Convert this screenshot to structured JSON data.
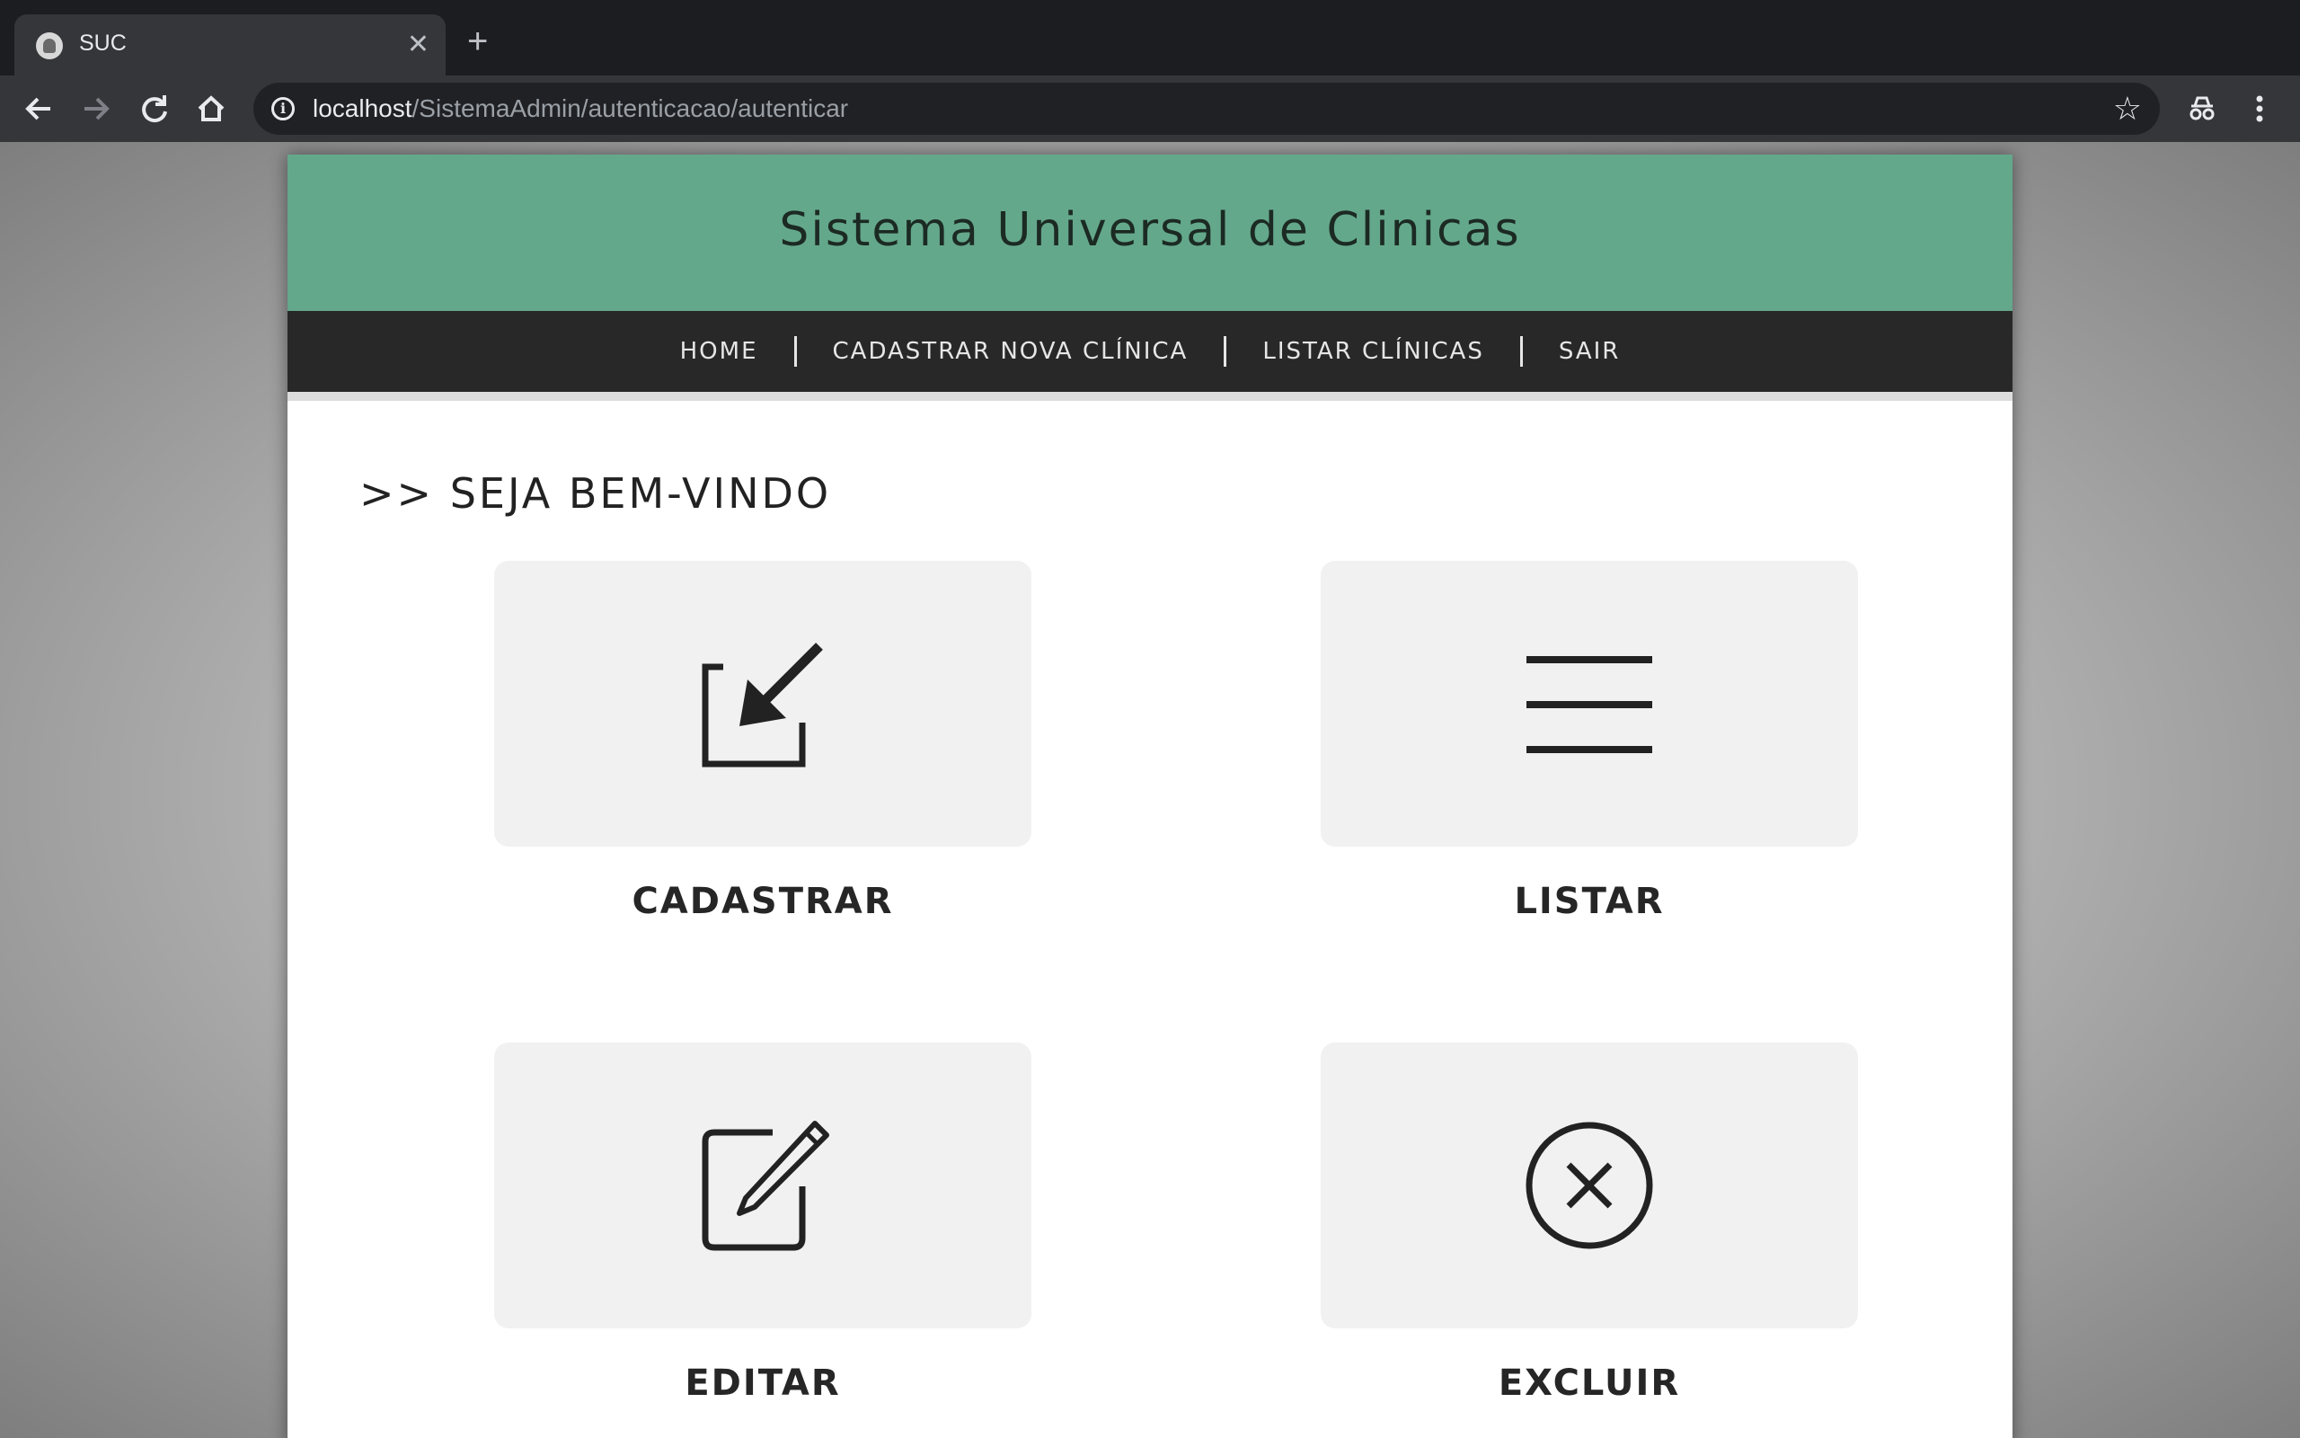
{
  "browser": {
    "tab_title": "SUC",
    "url_host": "localhost",
    "url_path": "/SistemaAdmin/autenticacao/autenticar"
  },
  "site": {
    "title": "Sistema Universal de Clinicas",
    "nav": [
      "HOME",
      "CADASTRAR NOVA CLÍNICA",
      "LISTAR CLÍNICAS",
      "SAIR"
    ],
    "welcome": ">> SEJA BEM-VINDO",
    "cards": [
      {
        "label": "CADASTRAR",
        "icon": "edit-arrow-icon"
      },
      {
        "label": "LISTAR",
        "icon": "list-icon"
      },
      {
        "label": "EDITAR",
        "icon": "pencil-square-icon"
      },
      {
        "label": "EXCLUIR",
        "icon": "close-circle-icon"
      }
    ]
  },
  "colors": {
    "header_green": "#64a88b",
    "nav_dark": "#282828",
    "card_bg": "#f1f1f1"
  }
}
